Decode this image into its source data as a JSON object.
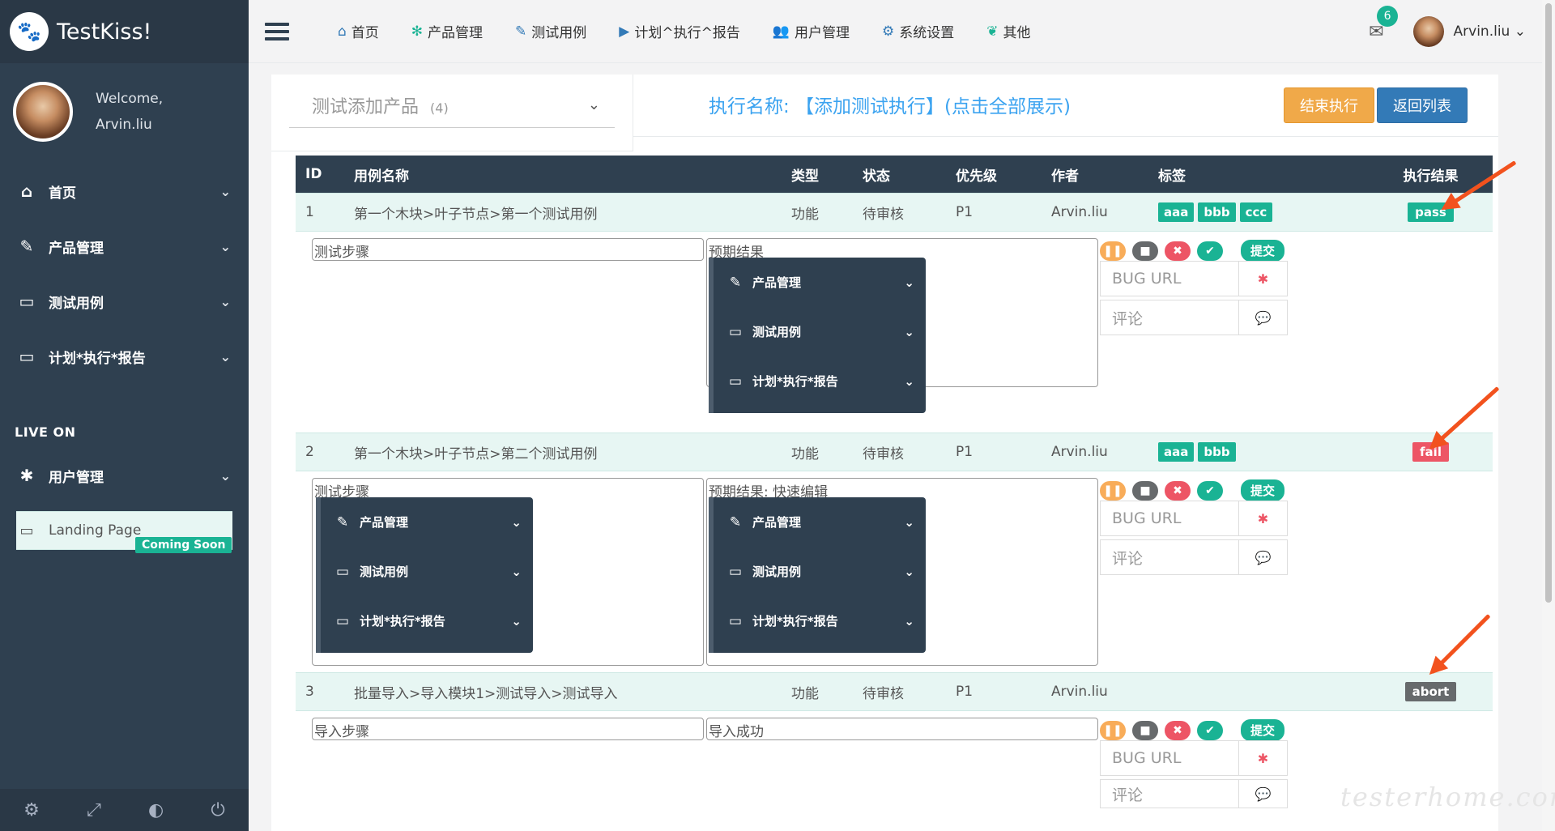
{
  "brand": {
    "name": "TestKiss!"
  },
  "profile": {
    "welcome": "Welcome,",
    "username": "Arvin.liu"
  },
  "sidebar": {
    "items": [
      {
        "label": "首页"
      },
      {
        "label": "产品管理"
      },
      {
        "label": "测试用例"
      },
      {
        "label": "计划*执行*报告"
      }
    ],
    "section_label": "LIVE ON",
    "live_items": [
      {
        "label": "用户管理"
      }
    ],
    "landing": {
      "label": "Landing Page",
      "badge": "Coming Soon"
    }
  },
  "topnav": {
    "items": [
      {
        "label": "首页"
      },
      {
        "label": "产品管理"
      },
      {
        "label": "测试用例"
      },
      {
        "label": "计划^执行^报告"
      },
      {
        "label": "用户管理"
      },
      {
        "label": "系统设置"
      },
      {
        "label": "其他"
      }
    ],
    "mail_count": "6",
    "user": "Arvin.liu"
  },
  "product": {
    "name": "测试添加产品",
    "count": "(4)"
  },
  "execution": {
    "title": "执行名称: 【添加测试执行】(点击全部展示)"
  },
  "buttons": {
    "end": "结束执行",
    "back": "返回列表"
  },
  "table": {
    "headers": [
      "ID",
      "用例名称",
      "类型",
      "状态",
      "优先级",
      "作者",
      "标签",
      "执行结果"
    ],
    "rows": [
      {
        "id": "1",
        "name": "第一个木块>叶子节点>第一个测试用例",
        "type": "功能",
        "state": "待审核",
        "priority": "P1",
        "author": "Arvin.liu",
        "tags": [
          "aaa",
          "bbb",
          "ccc"
        ],
        "result": "pass",
        "steps_label": "测试步骤",
        "expected_label": "预期结果"
      },
      {
        "id": "2",
        "name": "第一个木块>叶子节点>第二个测试用例",
        "type": "功能",
        "state": "待审核",
        "priority": "P1",
        "author": "Arvin.liu",
        "tags": [
          "aaa",
          "bbb"
        ],
        "result": "fail",
        "steps_label": "测试步骤",
        "expected_label": "预期结果: 快速编辑"
      },
      {
        "id": "3",
        "name": "批量导入>导入模块1>测试导入>测试导入",
        "type": "功能",
        "state": "待审核",
        "priority": "P1",
        "author": "Arvin.liu",
        "tags": [],
        "result": "abort",
        "steps_label": "导入步骤",
        "expected_label": "导入成功"
      }
    ]
  },
  "menu": {
    "items": [
      {
        "label": "产品管理"
      },
      {
        "label": "测试用例"
      },
      {
        "label": "计划*执行*报告"
      }
    ]
  },
  "controls": {
    "submit": "提交",
    "bug_placeholder": "BUG URL",
    "comment_placeholder": "评论"
  },
  "watermark": "testerhome.com",
  "colors": {
    "sidebar": "#2f4050",
    "accent": "#1ab394",
    "blue": "#337ab7",
    "orange": "#f0a949",
    "danger": "#ed5565",
    "title": "#3ba3f0",
    "arrow": "#f2521e"
  }
}
